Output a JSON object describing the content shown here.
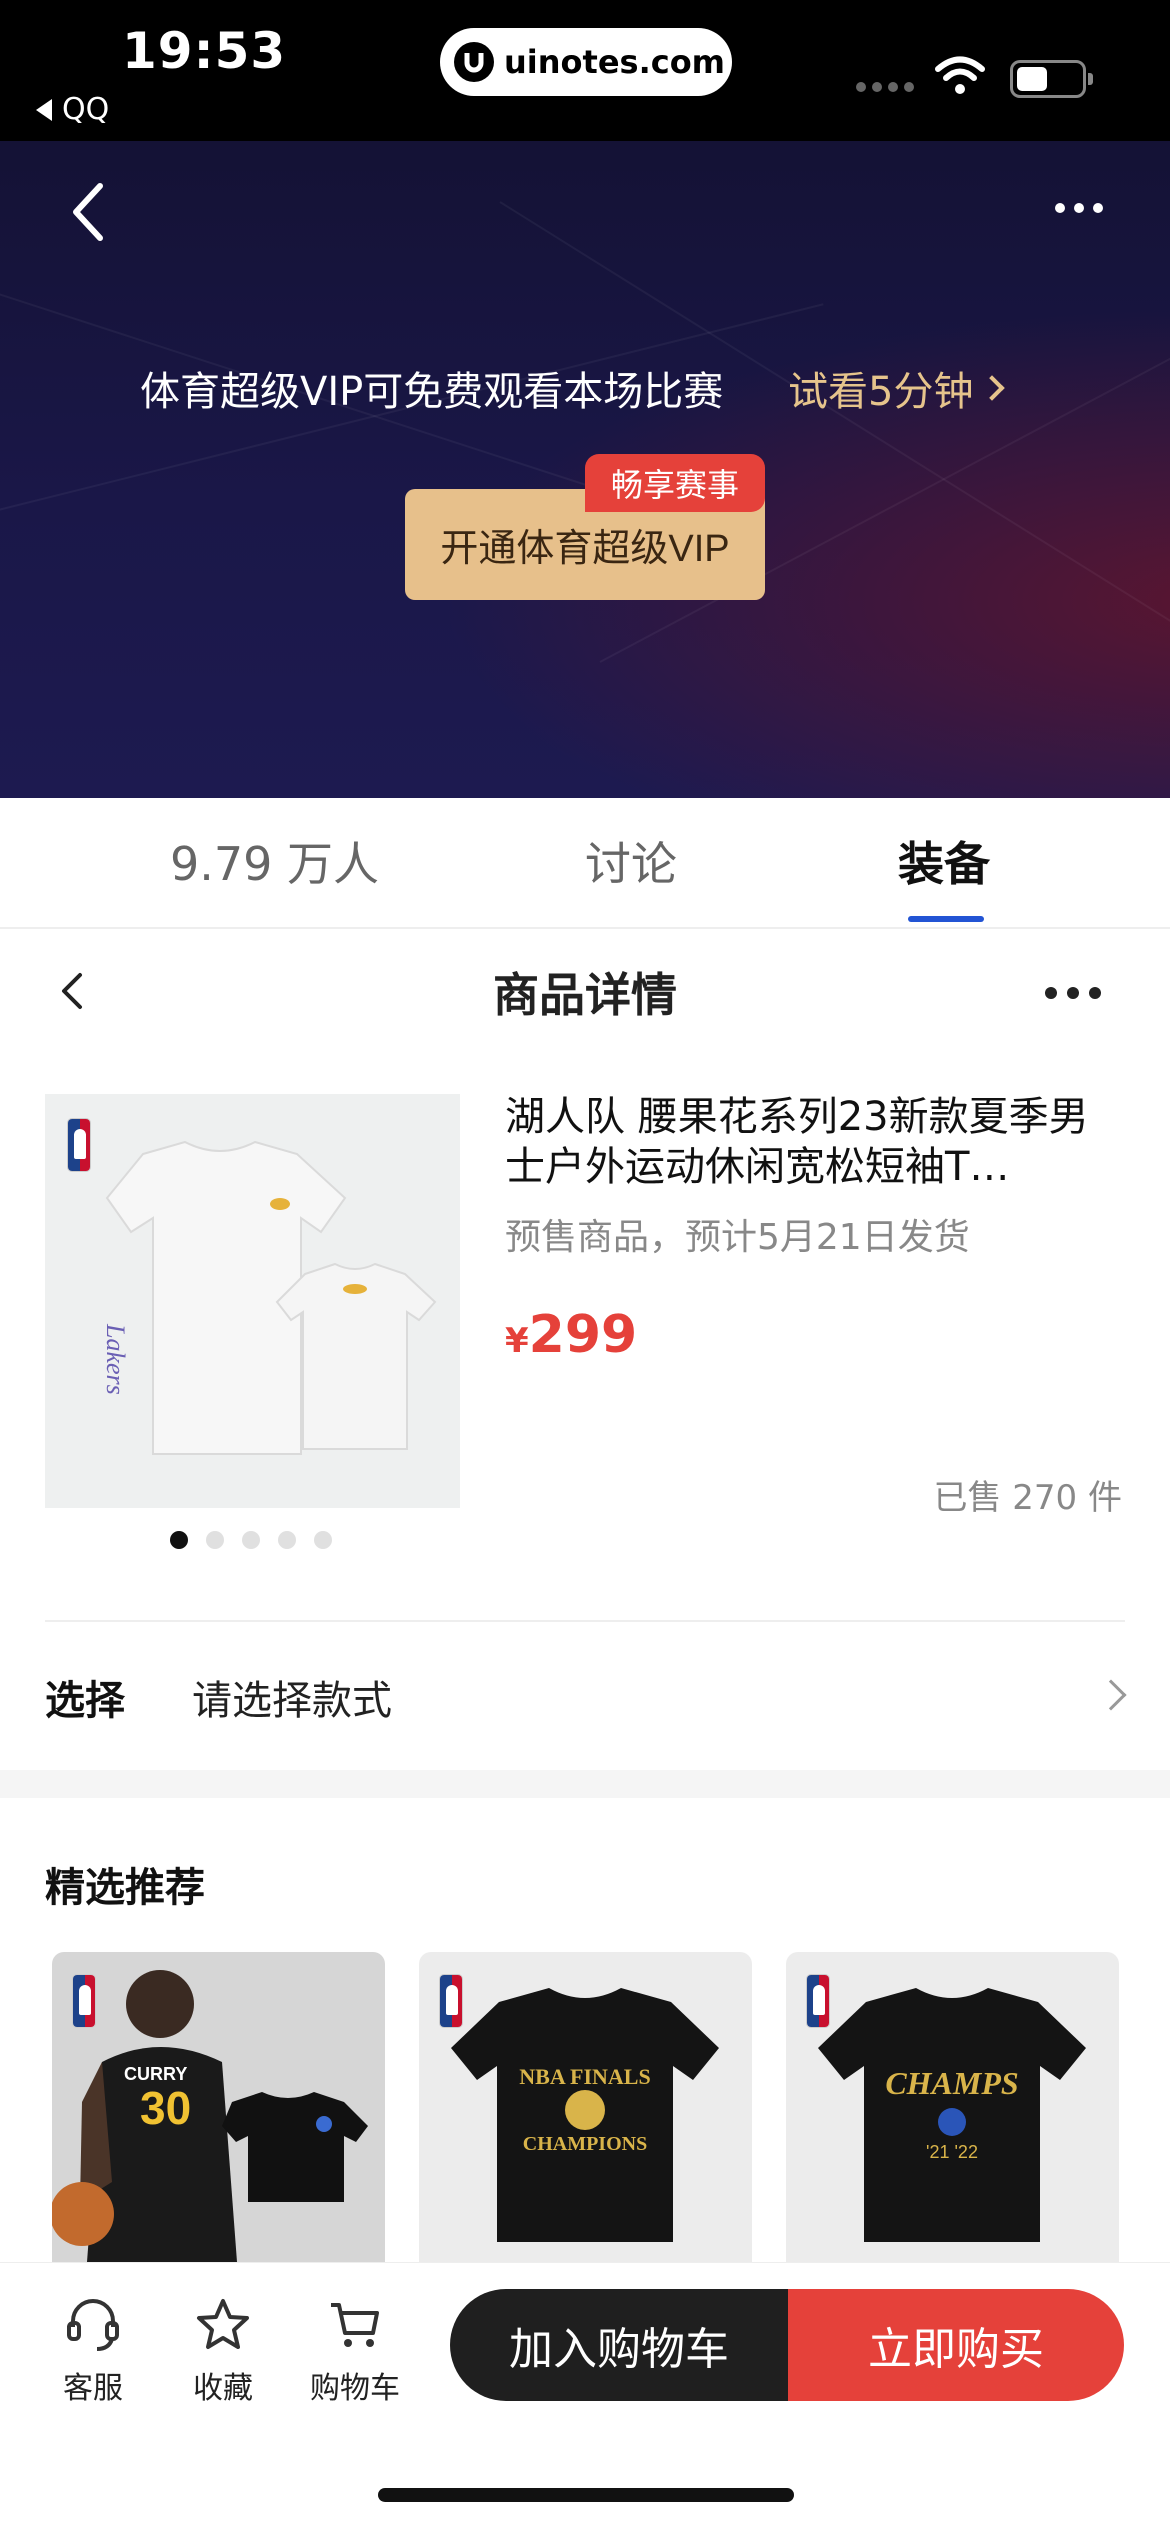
{
  "status": {
    "time": "19:53",
    "back_app": "QQ",
    "url": "uinotes.com"
  },
  "banner": {
    "message": "体育超级VIP可免费观看本场比赛",
    "trial_link": "试看5分钟",
    "vip_button": "开通体育超级VIP",
    "vip_badge": "畅享赛事",
    "colors": {
      "vip_button": "#e7c08b",
      "badge": "#e5413a",
      "trial_text": "#e6c48c"
    }
  },
  "tabs": [
    {
      "label": "9.79 万人",
      "active": false
    },
    {
      "label": "讨论",
      "active": false
    },
    {
      "label": "装备",
      "active": true
    }
  ],
  "detail": {
    "title": "商品详情"
  },
  "product": {
    "title": "湖人队  腰果花系列23新款夏季男士户外运动休闲宽松短袖T…",
    "presale": "预售商品，预计5月21日发货",
    "currency": "¥",
    "price": "299",
    "sold": "已售 270 件",
    "image_count": 5,
    "image_index": 1
  },
  "select": {
    "label": "选择",
    "value": "请选择款式"
  },
  "recommend": {
    "title": "精选推荐",
    "items": [
      {
        "shirt_text": "CURRY",
        "number": "30"
      },
      {
        "shirt_text": "NBA FINALS",
        "sub": "CHAMPIONS"
      },
      {
        "shirt_text": "CHAMPS",
        "sub": "'21 '22"
      }
    ]
  },
  "bottom_bar": {
    "service": "客服",
    "favorite": "收藏",
    "cart": "购物车",
    "add_to_cart": "加入购物车",
    "buy_now": "立即购买",
    "colors": {
      "cart_btn": "#1f1f1f",
      "buy_btn": "#e5413a"
    }
  }
}
